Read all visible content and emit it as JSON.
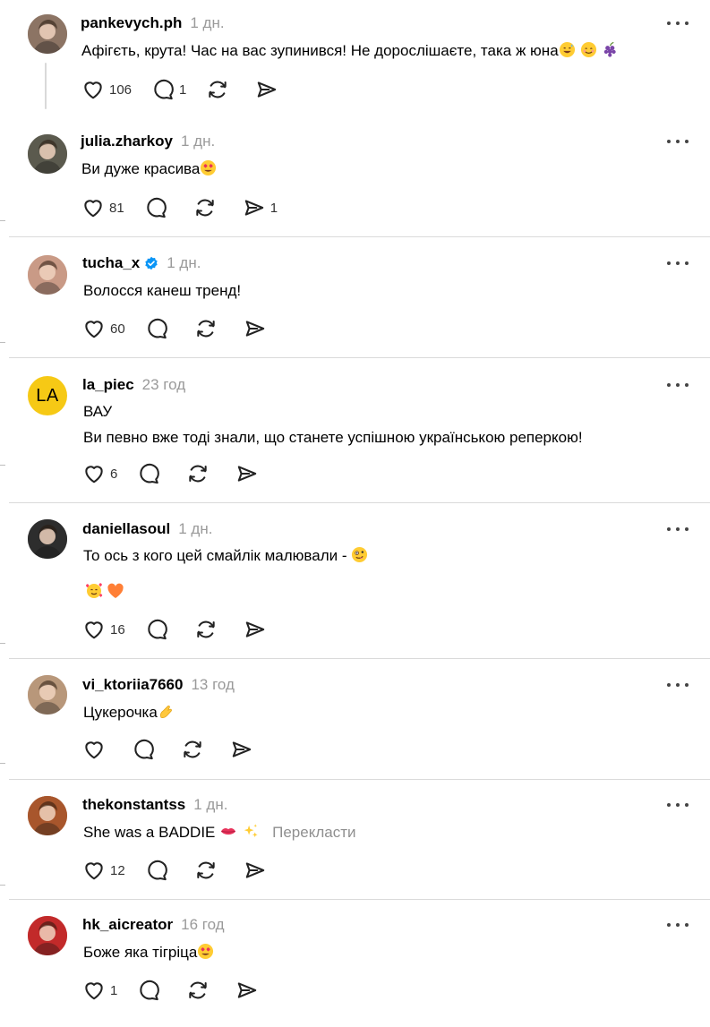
{
  "posts": [
    {
      "username": "pankevych.ph",
      "time": "1 дн.",
      "lines": [
        "Афігєть, крута! Час на вас зупинився! Не дорослішаєте, така ж юна"
      ],
      "trail": [
        "grin-sweat",
        "smile",
        "grape"
      ],
      "likes": "106",
      "replies": "1",
      "reposts": "",
      "shares": "",
      "avatar_color": "#8c7464"
    },
    {
      "username": "julia.zharkoy",
      "time": "1 дн.",
      "lines": [
        "Ви дуже красива"
      ],
      "trail": [
        "heart-eyes"
      ],
      "likes": "81",
      "replies": "",
      "reposts": "",
      "shares": "1",
      "avatar_color": "#5b5a4e"
    },
    {
      "username": "tucha_x",
      "time": "1 дн.",
      "verified": true,
      "lines": [
        "Волосся канеш тренд!"
      ],
      "trail": [],
      "likes": "60",
      "replies": "",
      "reposts": "",
      "shares": "",
      "avatar_color": "#c99a86"
    },
    {
      "username": "la_piec",
      "time": "23 год",
      "lines": [
        "ВАУ",
        "Ви певно вже тоді знали, що станете успішною українською реперкою!"
      ],
      "trail": [],
      "likes": "6",
      "replies": "",
      "reposts": "",
      "shares": "",
      "avatar_initials": "LA",
      "avatar_color": "#f6c915"
    },
    {
      "username": "daniellasoul",
      "time": "1 дн.",
      "lines": [
        "То ось з кого цей смайлік малювали - "
      ],
      "trail": [
        "zany"
      ],
      "extra_emoji": [
        "smiling-hearts",
        "orange-heart"
      ],
      "likes": "16",
      "replies": "",
      "reposts": "",
      "shares": "",
      "avatar_color": "#2d2d2d"
    },
    {
      "username": "vi_ktoriia7660",
      "time": "13 год",
      "lines": [
        "Цукерочка"
      ],
      "trail": [
        "pinch"
      ],
      "likes": "",
      "replies": "",
      "reposts": "",
      "shares": "",
      "avatar_color": "#b8977a"
    },
    {
      "username": "thekonstantss",
      "time": "1 дн.",
      "lines": [
        "She was a BADDIE "
      ],
      "trail": [
        "lips",
        "sparkles"
      ],
      "translate": "Перекласти",
      "likes": "12",
      "replies": "",
      "reposts": "",
      "shares": "",
      "avatar_color": "#a8562c"
    },
    {
      "username": "hk_aicreator",
      "time": "16 год",
      "lines": [
        "Боже яка тігріца"
      ],
      "trail": [
        "heart-eyes"
      ],
      "likes": "1",
      "replies": "",
      "reposts": "",
      "shares": "",
      "avatar_color": "#c22a2a"
    }
  ],
  "icons": {
    "like": "heart-icon",
    "reply": "comment-icon",
    "repost": "repost-icon",
    "share": "share-icon",
    "menu": "more-icon",
    "verified": "verified-badge-icon"
  }
}
